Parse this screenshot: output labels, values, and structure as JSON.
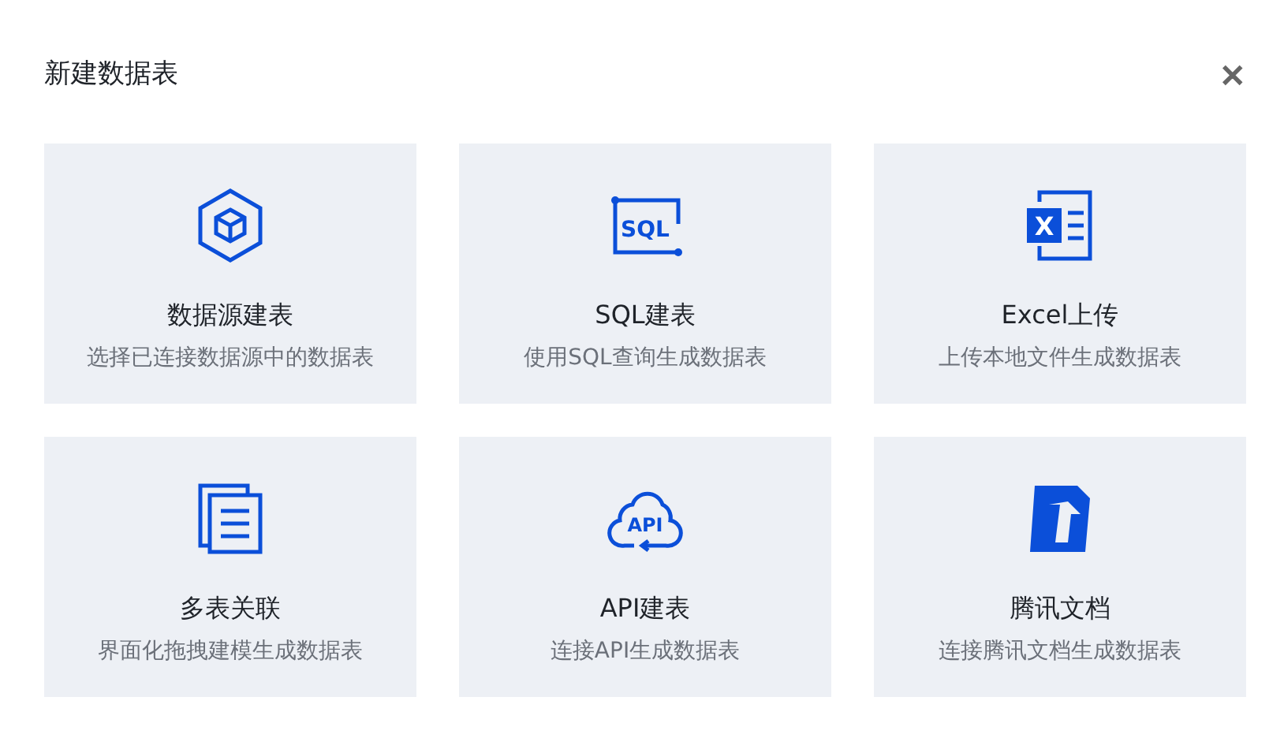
{
  "dialog": {
    "title": "新建数据表",
    "close": "✕"
  },
  "cards": [
    {
      "kind": "datasource",
      "title": "数据源建表",
      "description": "选择已连接数据源中的数据表"
    },
    {
      "kind": "sql",
      "icon_text": "SQL",
      "title": "SQL建表",
      "description": "使用SQL查询生成数据表"
    },
    {
      "kind": "excel",
      "icon_text": "X",
      "title": "Excel上传",
      "description": "上传本地文件生成数据表"
    },
    {
      "kind": "multi",
      "title": "多表关联",
      "description": "界面化拖拽建模生成数据表"
    },
    {
      "kind": "api",
      "icon_text": "API",
      "title": "API建表",
      "description": "连接API生成数据表"
    },
    {
      "kind": "tencentdoc",
      "title": "腾讯文档",
      "description": "连接腾讯文档生成数据表"
    }
  ]
}
